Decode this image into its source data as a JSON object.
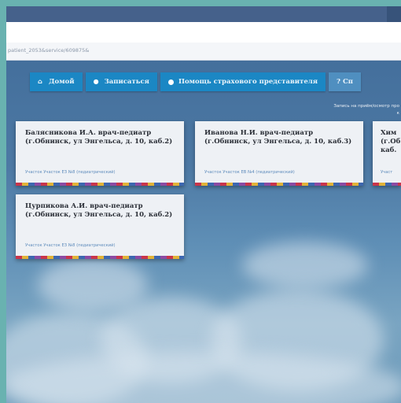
{
  "browser": {
    "url": "patient_2053&service/609875&"
  },
  "nav": {
    "items": [
      {
        "label": "Домой",
        "icon": "home-icon"
      },
      {
        "label": "Записаться",
        "icon": "chat-icon"
      },
      {
        "label": "Помощь страхового представителя",
        "icon": "dot-icon"
      },
      {
        "label": "? Сп",
        "icon": "help-icon"
      }
    ]
  },
  "note": {
    "line1": "Запись на приём/осмотр про",
    "line2": "к"
  },
  "cards": [
    {
      "title": "Балясникова И.А. врач-педиатр (г.Обнинск, ул Энгельса, д. 10, каб.2)",
      "sub": "Участок Участок ЕЗ №8 (педиатрический)"
    },
    {
      "title": "Иванова Н.И. врач-педиатр (г.Обнинск, ул Энгельса, д. 10, каб.3)",
      "sub": "Участок Участок ЕВ №4 (педиатрический)"
    },
    {
      "title": "Хим (г.Об каб.",
      "sub": "Участ"
    },
    {
      "title": "Цурпикова А.И. врач-педиатр (г.Обнинск, ул Энгельса, д. 10, каб.2)",
      "sub": "Участок Участок ЕЗ №8 (педиатрический)"
    }
  ],
  "colors": {
    "nav_button": "#1b87c4",
    "card_bg": "#eef1f5",
    "frame": "#69b2b0"
  }
}
